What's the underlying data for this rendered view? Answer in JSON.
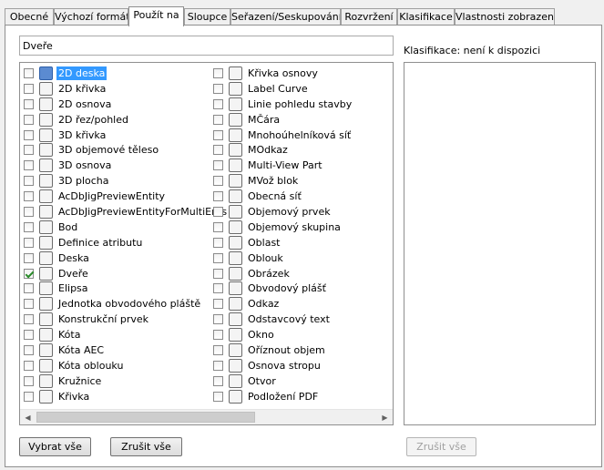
{
  "tabs": [
    {
      "label": "Obecné",
      "active": false
    },
    {
      "label": "Výchozí formát",
      "active": false
    },
    {
      "label": "Použít na",
      "active": true
    },
    {
      "label": "Sloupce",
      "active": false
    },
    {
      "label": "Seřazení/Seskupování",
      "active": false
    },
    {
      "label": "Rozvržení",
      "active": false
    },
    {
      "label": "Klasifikace",
      "active": false
    },
    {
      "label": "Vlastnosti zobrazení",
      "active": false
    }
  ],
  "name_field": {
    "value": "Dveře"
  },
  "classification": {
    "label": "Klasifikace: není k dispozici"
  },
  "objects_left": [
    {
      "label": "2D deska",
      "checked": false,
      "selected": true,
      "icon": "2d-section-icon"
    },
    {
      "label": "2D křivka",
      "checked": false,
      "selected": false,
      "icon": "2d-curve-icon"
    },
    {
      "label": "2D osnova",
      "checked": false,
      "selected": false,
      "icon": "2d-grid-icon"
    },
    {
      "label": "2D řez/pohled",
      "checked": false,
      "selected": false,
      "icon": "section-view-icon"
    },
    {
      "label": "3D křivka",
      "checked": false,
      "selected": false,
      "icon": "3d-curve-icon"
    },
    {
      "label": "3D objemové těleso",
      "checked": false,
      "selected": false,
      "icon": "3d-solid-icon"
    },
    {
      "label": "3D osnova",
      "checked": false,
      "selected": false,
      "icon": "3d-grid-icon"
    },
    {
      "label": "3D plocha",
      "checked": false,
      "selected": false,
      "icon": "3d-face-icon"
    },
    {
      "label": "AcDbJigPreviewEntity",
      "checked": false,
      "selected": false,
      "icon": "entity-icon"
    },
    {
      "label": "AcDbJigPreviewEntityForMultiEnts",
      "checked": false,
      "selected": false,
      "icon": "entity-icon"
    },
    {
      "label": "Bod",
      "checked": false,
      "selected": false,
      "icon": "point-icon"
    },
    {
      "label": "Definice atributu",
      "checked": false,
      "selected": false,
      "icon": "tag-icon"
    },
    {
      "label": "Deska",
      "checked": false,
      "selected": false,
      "icon": "slab-icon"
    },
    {
      "label": "Dveře",
      "checked": true,
      "selected": false,
      "icon": "door-icon"
    },
    {
      "label": "Elipsa",
      "checked": false,
      "selected": false,
      "icon": "ellipse-icon"
    },
    {
      "label": "Jednotka obvodového pláště",
      "checked": false,
      "selected": false,
      "icon": "curtain-unit-icon"
    },
    {
      "label": "Konstrukční prvek",
      "checked": false,
      "selected": false,
      "icon": "structural-member-icon"
    },
    {
      "label": "Kóta",
      "checked": false,
      "selected": false,
      "icon": "dimension-icon"
    },
    {
      "label": "Kóta AEC",
      "checked": false,
      "selected": false,
      "icon": "aec-dimension-icon"
    },
    {
      "label": "Kóta oblouku",
      "checked": false,
      "selected": false,
      "icon": "arc-dimension-icon"
    },
    {
      "label": "Kružnice",
      "checked": false,
      "selected": false,
      "icon": "circle-icon"
    },
    {
      "label": "Křivka",
      "checked": false,
      "selected": false,
      "icon": "polyline-icon"
    }
  ],
  "objects_right": [
    {
      "label": "Křivka osnovy",
      "checked": false,
      "icon": "grid-curve-icon"
    },
    {
      "label": "Label Curve",
      "checked": false,
      "icon": "label-curve-icon"
    },
    {
      "label": "Linie pohledu stavby",
      "checked": false,
      "icon": "building-line-icon"
    },
    {
      "label": "MČára",
      "checked": false,
      "icon": "mline-icon"
    },
    {
      "label": "Mnohoúhelníková síť",
      "checked": false,
      "icon": "polyface-mesh-icon"
    },
    {
      "label": "MOdkaz",
      "checked": false,
      "icon": "mleader-icon"
    },
    {
      "label": "Multi-View Part",
      "checked": false,
      "icon": "multiview-part-icon"
    },
    {
      "label": "MVož blok",
      "checked": false,
      "icon": "mv-block-icon"
    },
    {
      "label": "Obecná síť",
      "checked": false,
      "icon": "mesh-icon"
    },
    {
      "label": "Objemový prvek",
      "checked": false,
      "icon": "mass-element-icon"
    },
    {
      "label": "Objemový skupina",
      "checked": false,
      "icon": "mass-group-icon"
    },
    {
      "label": "Oblast",
      "checked": false,
      "icon": "region-icon"
    },
    {
      "label": "Oblouk",
      "checked": false,
      "icon": "arc-icon"
    },
    {
      "label": "Obrázek",
      "checked": false,
      "icon": "image-icon"
    },
    {
      "label": "Obvodový plášť",
      "checked": false,
      "icon": "curtain-wall-icon"
    },
    {
      "label": "Odkaz",
      "checked": false,
      "icon": "leader-icon"
    },
    {
      "label": "Odstavcový text",
      "checked": false,
      "icon": "mtext-icon"
    },
    {
      "label": "Okno",
      "checked": false,
      "icon": "window-icon"
    },
    {
      "label": "Oříznout objem",
      "checked": false,
      "icon": "clip-volume-icon"
    },
    {
      "label": "Osnova stropu",
      "checked": false,
      "icon": "ceiling-grid-icon"
    },
    {
      "label": "Otvor",
      "checked": false,
      "icon": "opening-icon"
    },
    {
      "label": "Podložení PDF",
      "checked": false,
      "icon": "pdf-underlay-icon"
    }
  ],
  "buttons": {
    "select_all": "Vybrat vše",
    "clear_all": "Zrušit vše",
    "clear_all_classification": "Zrušit vše"
  }
}
